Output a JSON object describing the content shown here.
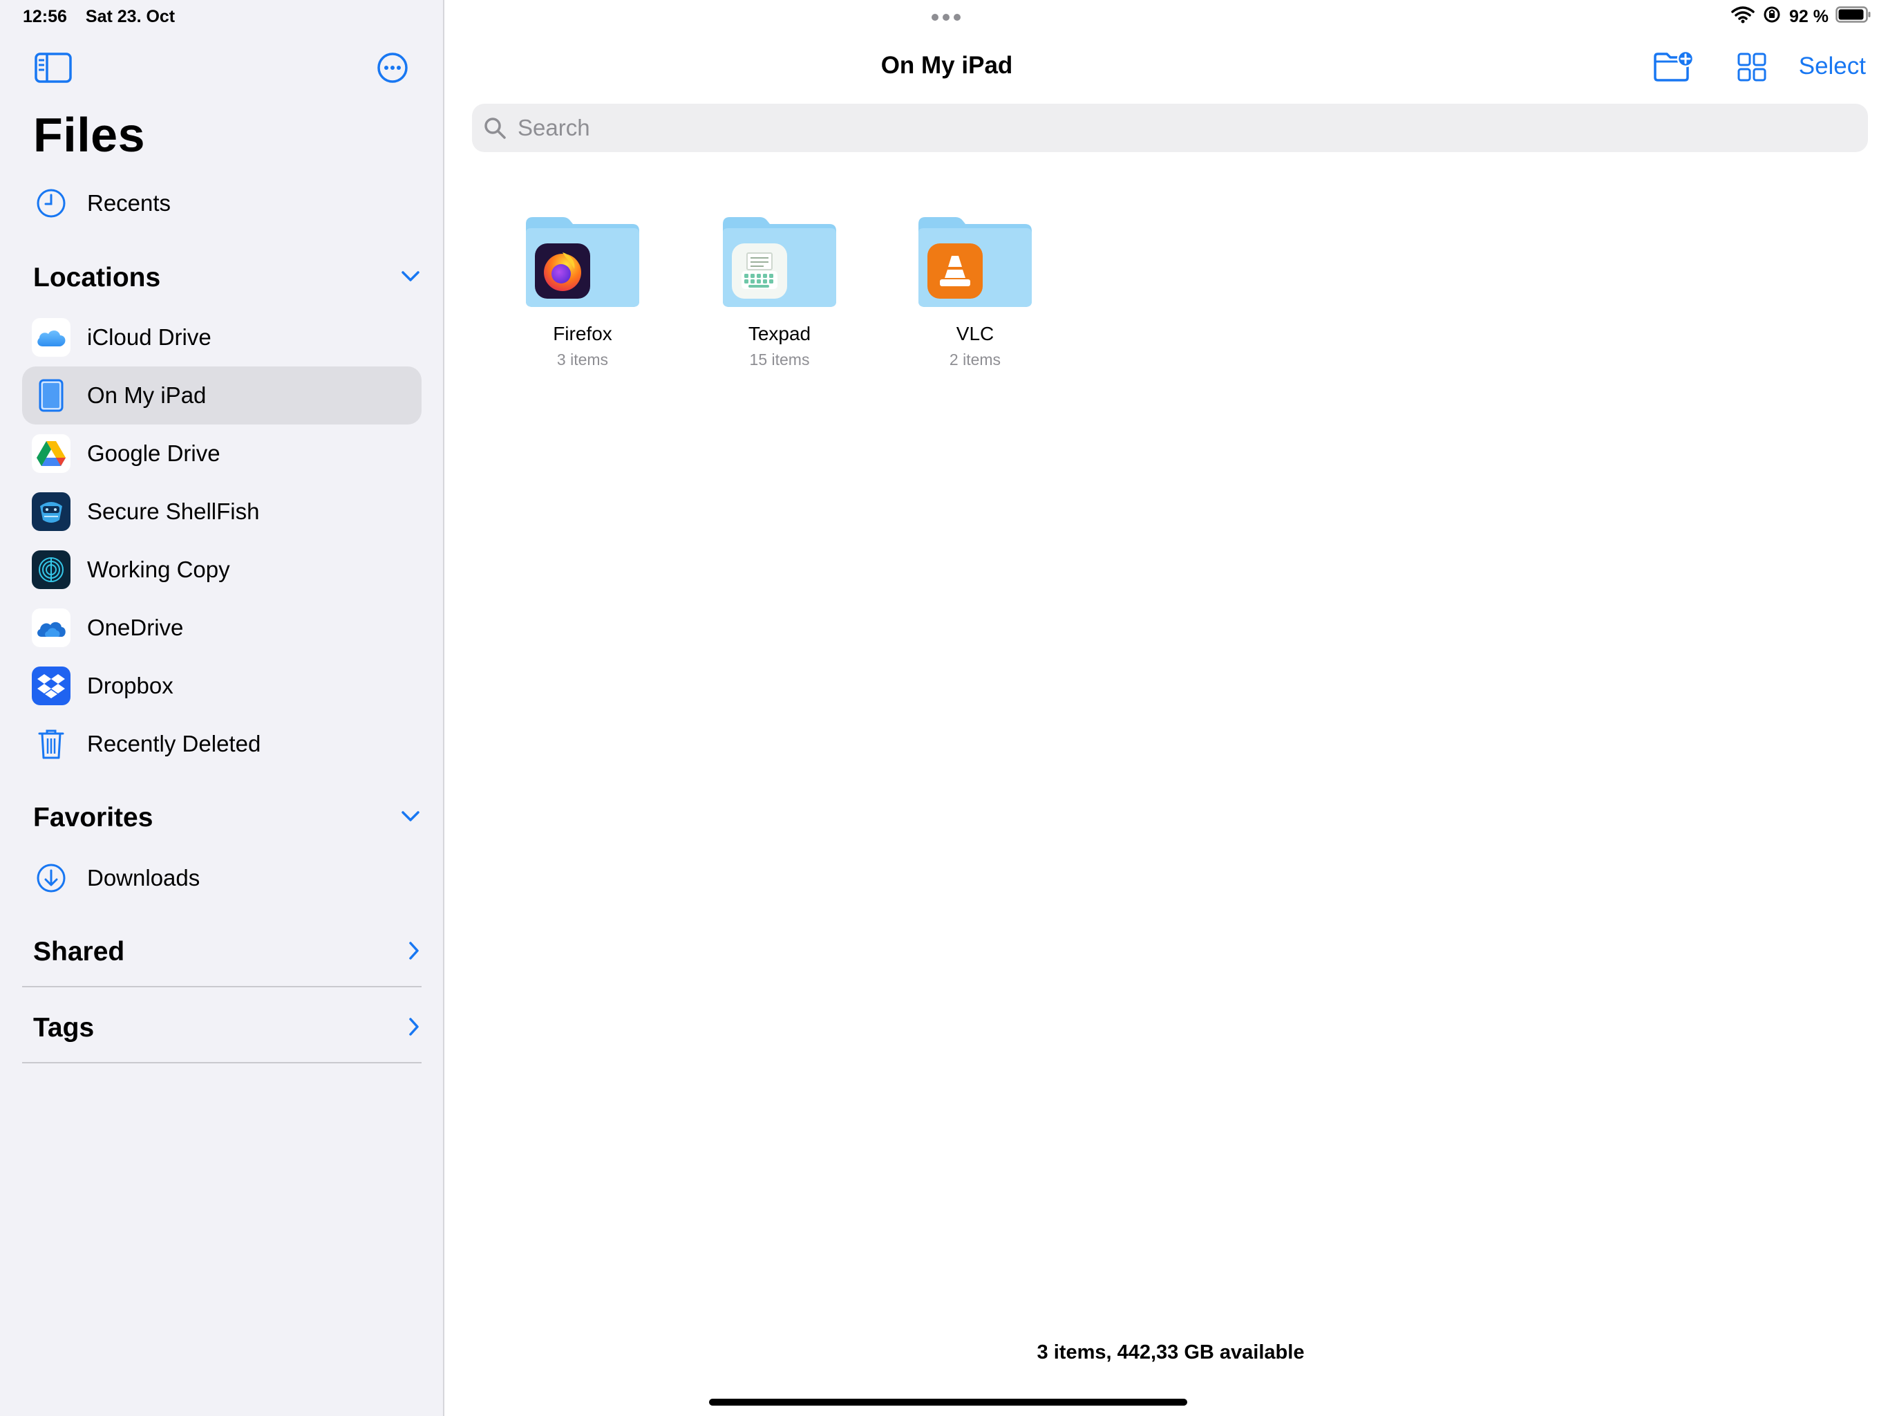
{
  "status": {
    "time": "12:56",
    "date": "Sat 23. Oct",
    "battery": "92 %"
  },
  "sidebar": {
    "title": "Files",
    "recents": "Recents",
    "sections": {
      "locations": "Locations",
      "favorites": "Favorites",
      "shared": "Shared",
      "tags": "Tags"
    },
    "locations": [
      {
        "label": "iCloud Drive",
        "icon": "icloud-icon"
      },
      {
        "label": "On My iPad",
        "icon": "ipad-icon",
        "selected": true
      },
      {
        "label": "Google Drive",
        "icon": "google-drive-icon"
      },
      {
        "label": "Secure ShellFish",
        "icon": "secure-shellfish-icon"
      },
      {
        "label": "Working Copy",
        "icon": "working-copy-icon"
      },
      {
        "label": "OneDrive",
        "icon": "onedrive-icon"
      },
      {
        "label": "Dropbox",
        "icon": "dropbox-icon"
      },
      {
        "label": "Recently Deleted",
        "icon": "trash-icon"
      }
    ],
    "favorites": [
      {
        "label": "Downloads",
        "icon": "download-icon"
      }
    ]
  },
  "main": {
    "title": "On My iPad",
    "select_label": "Select",
    "search_placeholder": "Search",
    "folders": [
      {
        "name": "Firefox",
        "count": "3 items",
        "icon": "firefox-icon"
      },
      {
        "name": "Texpad",
        "count": "15 items",
        "icon": "texpad-icon"
      },
      {
        "name": "VLC",
        "count": "2 items",
        "icon": "vlc-icon"
      }
    ],
    "footer": "3 items, 442,33 GB available"
  },
  "colors": {
    "accent": "#1877f2",
    "folder": "#8fd0f5",
    "selected_row": "#dedee3"
  }
}
